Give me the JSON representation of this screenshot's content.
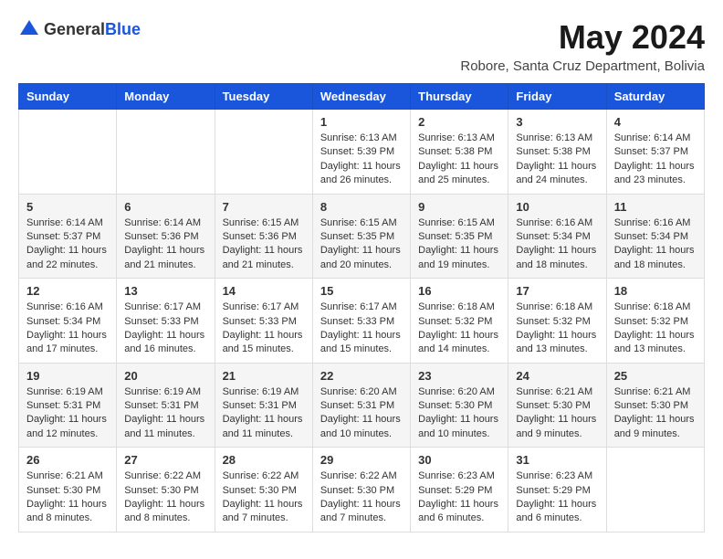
{
  "header": {
    "logo_general": "General",
    "logo_blue": "Blue",
    "title": "May 2024",
    "subtitle": "Robore, Santa Cruz Department, Bolivia"
  },
  "days_of_week": [
    "Sunday",
    "Monday",
    "Tuesday",
    "Wednesday",
    "Thursday",
    "Friday",
    "Saturday"
  ],
  "weeks": [
    [
      {
        "day": "",
        "info": ""
      },
      {
        "day": "",
        "info": ""
      },
      {
        "day": "",
        "info": ""
      },
      {
        "day": "1",
        "info": "Sunrise: 6:13 AM\nSunset: 5:39 PM\nDaylight: 11 hours and 26 minutes."
      },
      {
        "day": "2",
        "info": "Sunrise: 6:13 AM\nSunset: 5:38 PM\nDaylight: 11 hours and 25 minutes."
      },
      {
        "day": "3",
        "info": "Sunrise: 6:13 AM\nSunset: 5:38 PM\nDaylight: 11 hours and 24 minutes."
      },
      {
        "day": "4",
        "info": "Sunrise: 6:14 AM\nSunset: 5:37 PM\nDaylight: 11 hours and 23 minutes."
      }
    ],
    [
      {
        "day": "5",
        "info": "Sunrise: 6:14 AM\nSunset: 5:37 PM\nDaylight: 11 hours and 22 minutes."
      },
      {
        "day": "6",
        "info": "Sunrise: 6:14 AM\nSunset: 5:36 PM\nDaylight: 11 hours and 21 minutes."
      },
      {
        "day": "7",
        "info": "Sunrise: 6:15 AM\nSunset: 5:36 PM\nDaylight: 11 hours and 21 minutes."
      },
      {
        "day": "8",
        "info": "Sunrise: 6:15 AM\nSunset: 5:35 PM\nDaylight: 11 hours and 20 minutes."
      },
      {
        "day": "9",
        "info": "Sunrise: 6:15 AM\nSunset: 5:35 PM\nDaylight: 11 hours and 19 minutes."
      },
      {
        "day": "10",
        "info": "Sunrise: 6:16 AM\nSunset: 5:34 PM\nDaylight: 11 hours and 18 minutes."
      },
      {
        "day": "11",
        "info": "Sunrise: 6:16 AM\nSunset: 5:34 PM\nDaylight: 11 hours and 18 minutes."
      }
    ],
    [
      {
        "day": "12",
        "info": "Sunrise: 6:16 AM\nSunset: 5:34 PM\nDaylight: 11 hours and 17 minutes."
      },
      {
        "day": "13",
        "info": "Sunrise: 6:17 AM\nSunset: 5:33 PM\nDaylight: 11 hours and 16 minutes."
      },
      {
        "day": "14",
        "info": "Sunrise: 6:17 AM\nSunset: 5:33 PM\nDaylight: 11 hours and 15 minutes."
      },
      {
        "day": "15",
        "info": "Sunrise: 6:17 AM\nSunset: 5:33 PM\nDaylight: 11 hours and 15 minutes."
      },
      {
        "day": "16",
        "info": "Sunrise: 6:18 AM\nSunset: 5:32 PM\nDaylight: 11 hours and 14 minutes."
      },
      {
        "day": "17",
        "info": "Sunrise: 6:18 AM\nSunset: 5:32 PM\nDaylight: 11 hours and 13 minutes."
      },
      {
        "day": "18",
        "info": "Sunrise: 6:18 AM\nSunset: 5:32 PM\nDaylight: 11 hours and 13 minutes."
      }
    ],
    [
      {
        "day": "19",
        "info": "Sunrise: 6:19 AM\nSunset: 5:31 PM\nDaylight: 11 hours and 12 minutes."
      },
      {
        "day": "20",
        "info": "Sunrise: 6:19 AM\nSunset: 5:31 PM\nDaylight: 11 hours and 11 minutes."
      },
      {
        "day": "21",
        "info": "Sunrise: 6:19 AM\nSunset: 5:31 PM\nDaylight: 11 hours and 11 minutes."
      },
      {
        "day": "22",
        "info": "Sunrise: 6:20 AM\nSunset: 5:31 PM\nDaylight: 11 hours and 10 minutes."
      },
      {
        "day": "23",
        "info": "Sunrise: 6:20 AM\nSunset: 5:30 PM\nDaylight: 11 hours and 10 minutes."
      },
      {
        "day": "24",
        "info": "Sunrise: 6:21 AM\nSunset: 5:30 PM\nDaylight: 11 hours and 9 minutes."
      },
      {
        "day": "25",
        "info": "Sunrise: 6:21 AM\nSunset: 5:30 PM\nDaylight: 11 hours and 9 minutes."
      }
    ],
    [
      {
        "day": "26",
        "info": "Sunrise: 6:21 AM\nSunset: 5:30 PM\nDaylight: 11 hours and 8 minutes."
      },
      {
        "day": "27",
        "info": "Sunrise: 6:22 AM\nSunset: 5:30 PM\nDaylight: 11 hours and 8 minutes."
      },
      {
        "day": "28",
        "info": "Sunrise: 6:22 AM\nSunset: 5:30 PM\nDaylight: 11 hours and 7 minutes."
      },
      {
        "day": "29",
        "info": "Sunrise: 6:22 AM\nSunset: 5:30 PM\nDaylight: 11 hours and 7 minutes."
      },
      {
        "day": "30",
        "info": "Sunrise: 6:23 AM\nSunset: 5:29 PM\nDaylight: 11 hours and 6 minutes."
      },
      {
        "day": "31",
        "info": "Sunrise: 6:23 AM\nSunset: 5:29 PM\nDaylight: 11 hours and 6 minutes."
      },
      {
        "day": "",
        "info": ""
      }
    ]
  ]
}
